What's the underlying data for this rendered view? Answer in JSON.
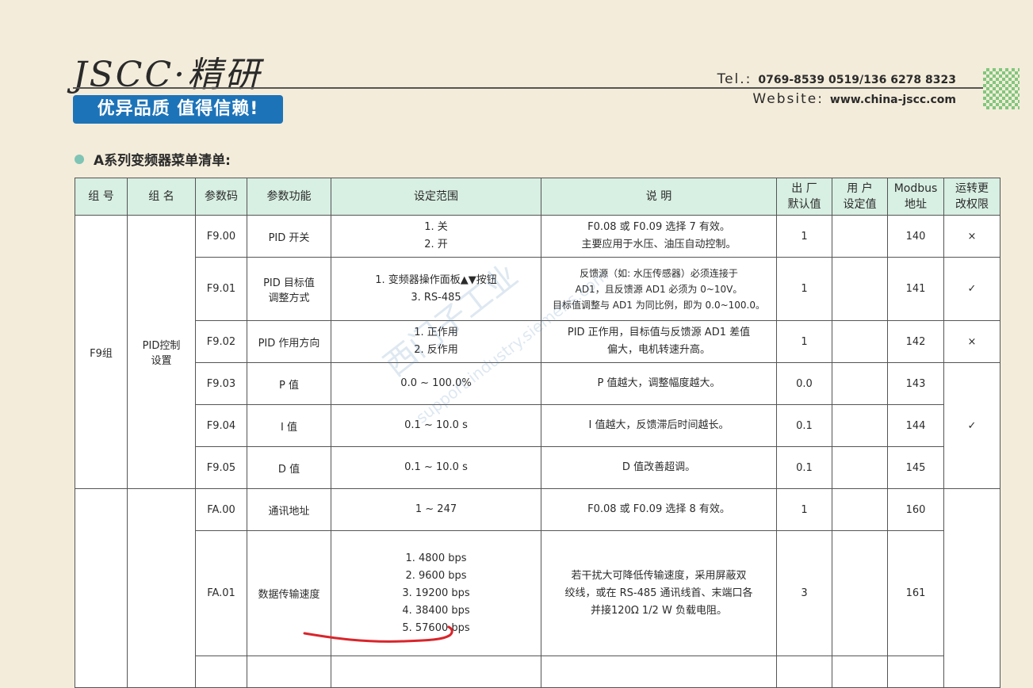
{
  "header": {
    "logo": "JSCC·精研",
    "slogan": "优异品质 值得信赖!",
    "tel_label": "Tel.:",
    "tel": "0769-8539 0519/136 6278 8323",
    "web_label": "Website:",
    "web": "www.china-jscc.com"
  },
  "section_title": "A系列变频器菜单清单:",
  "table": {
    "headers": [
      "组 号",
      "组 名",
      "参数码",
      "参数功能",
      "设定范围",
      "说 明",
      "出 厂\n默认值",
      "用 户\n设定值",
      "Modbus\n地址",
      "运转更\n改权限"
    ],
    "f9": {
      "group": "F9组",
      "group_name": "PID控制\n设置",
      "rows": [
        {
          "code": "F9.00",
          "func": "PID 开关",
          "range": "1. 关\n2. 开",
          "desc": "F0.08 或 F0.09 选择 7 有效。\n主要应用于水压、油压自动控制。",
          "default": "1",
          "modbus": "140",
          "perm": "×"
        },
        {
          "code": "F9.01",
          "func": "PID 目标值\n调整方式",
          "range": "1. 变频器操作面板▲▼按钮\n3. RS-485",
          "desc": "反馈源（如: 水压传感器）必须连接于\nAD1，且反馈源 AD1 必须为 0~10V。\n目标值调整与 AD1 为同比例，即为 0.0~100.0。",
          "default": "1",
          "modbus": "141",
          "perm": "✓"
        },
        {
          "code": "F9.02",
          "func": "PID 作用方向",
          "range": "1. 正作用\n2. 反作用",
          "desc": "PID 正作用，目标值与反馈源 AD1 差值\n偏大，电机转速升高。",
          "default": "1",
          "modbus": "142",
          "perm": "×"
        },
        {
          "code": "F9.03",
          "func": "P 值",
          "range": "0.0 ~ 100.0%",
          "desc": "P 值越大，调整幅度越大。",
          "default": "0.0",
          "modbus": "143"
        },
        {
          "code": "F9.04",
          "func": "I 值",
          "range": "0.1 ~ 10.0 s",
          "desc": "I 值越大，反馈滞后时间越长。",
          "default": "0.1",
          "modbus": "144"
        },
        {
          "code": "F9.05",
          "func": "D 值",
          "range": "0.1 ~ 10.0 s",
          "desc": "D 值改善超调。",
          "default": "0.1",
          "modbus": "145"
        }
      ],
      "merged_perm": "✓"
    },
    "fa": {
      "rows": [
        {
          "code": "FA.00",
          "func": "通讯地址",
          "range": "1 ~ 247",
          "desc": "F0.08 或 F0.09 选择 8 有效。",
          "default": "1",
          "modbus": "160"
        },
        {
          "code": "FA.01",
          "func": "数据传输速度",
          "range": "1. 4800 bps\n2. 9600 bps\n3. 19200 bps\n4. 38400 bps\n5. 57600 bps",
          "desc": "若干扰大可降低传输速度，采用屏蔽双\n绞线，或在 RS-485 通讯线首、末端口各\n并接120Ω 1/2 W 负载电阻。",
          "default": "3",
          "modbus": "161"
        }
      ]
    }
  },
  "watermark": "西门子工业",
  "watermark_url": "support.industry.siemens.com",
  "colors": {
    "header_bg": "#d8efe3",
    "slogan_bg": "#1d73b8",
    "page_bg": "#f3ecda",
    "pen": "#d9252b"
  }
}
